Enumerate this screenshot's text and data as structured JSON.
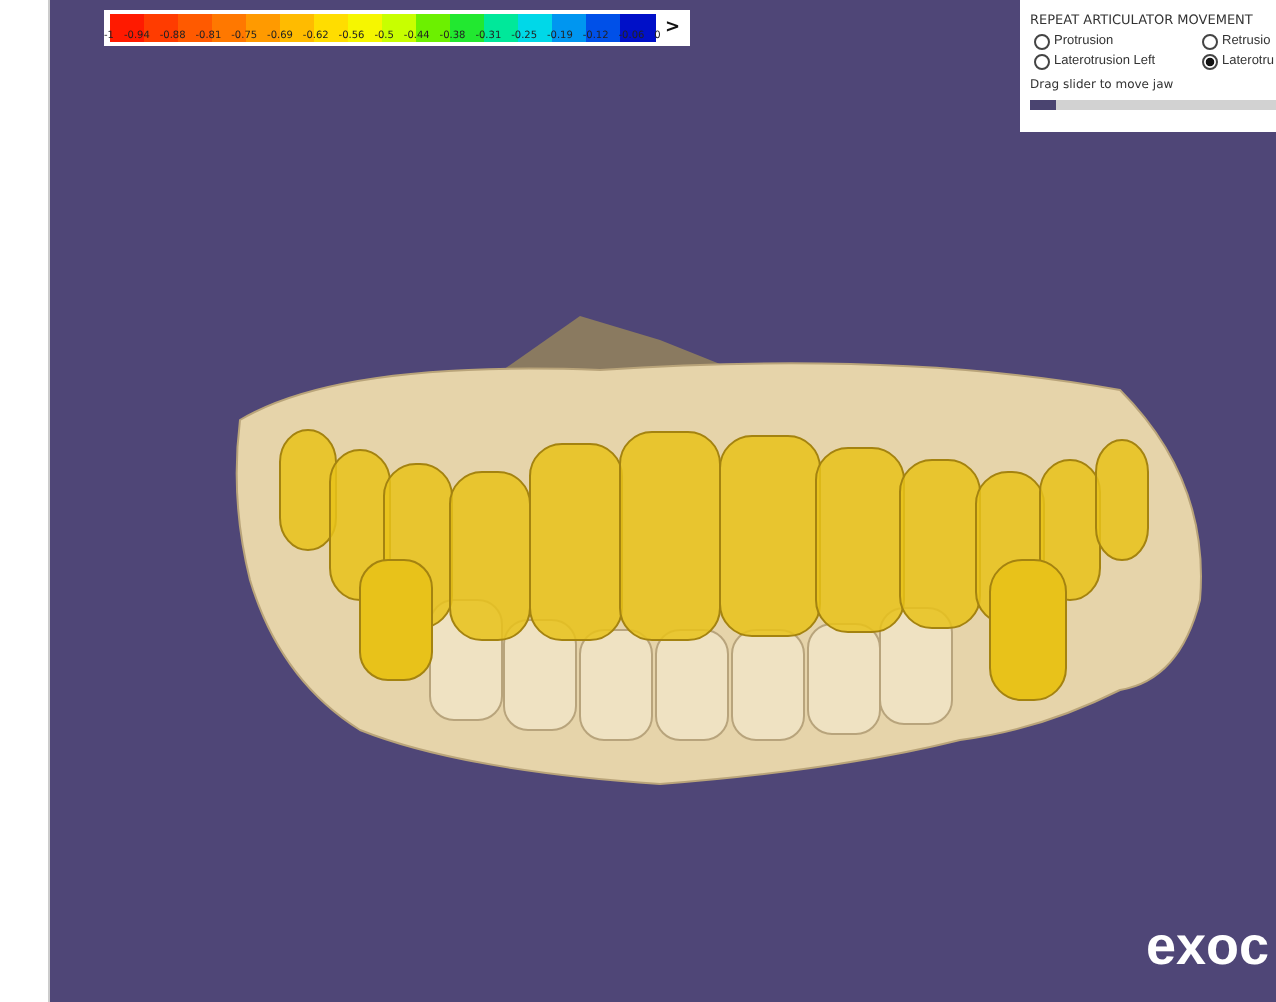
{
  "color_scale": {
    "segments": [
      {
        "label": "-1",
        "color": "#ff1a00"
      },
      {
        "label": "-0.94",
        "color": "#ff3c00"
      },
      {
        "label": "-0.88",
        "color": "#ff5a00"
      },
      {
        "label": "-0.81",
        "color": "#ff7800"
      },
      {
        "label": "-0.75",
        "color": "#ff9a00"
      },
      {
        "label": "-0.69",
        "color": "#ffbb00"
      },
      {
        "label": "-0.62",
        "color": "#ffdd00"
      },
      {
        "label": "-0.56",
        "color": "#f6f600"
      },
      {
        "label": "-0.5",
        "color": "#c8ff00"
      },
      {
        "label": "-0.44",
        "color": "#6cf000"
      },
      {
        "label": "-0.38",
        "color": "#22e830"
      },
      {
        "label": "-0.31",
        "color": "#00e89a"
      },
      {
        "label": "-0.25",
        "color": "#00d8e8"
      },
      {
        "label": "-0.19",
        "color": "#0096f0"
      },
      {
        "label": "-0.12",
        "color": "#0050e8"
      },
      {
        "label": "-0.06",
        "color": "#0010c8"
      }
    ],
    "end_label": "0",
    "toggle": ">"
  },
  "articulator_panel": {
    "title": "REPEAT ARTICULATOR MOVEMENT",
    "options": [
      {
        "label": "Protrusion",
        "selected": false
      },
      {
        "label": "Retrusio",
        "selected": false
      },
      {
        "label": "Laterotrusion Left",
        "selected": false
      },
      {
        "label": "Laterotru",
        "selected": true
      }
    ],
    "hint": "Drag slider to move jaw",
    "slider": {
      "level": 0.1
    }
  },
  "logo": "exoc"
}
